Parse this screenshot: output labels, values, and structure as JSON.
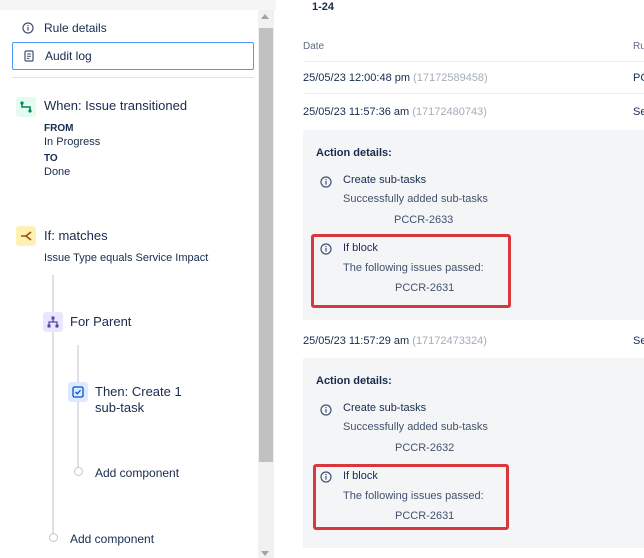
{
  "nav": {
    "rule_details": "Rule details",
    "audit_log": "Audit log"
  },
  "components": {
    "trigger": {
      "title": "When: Issue transitioned",
      "from_label": "FROM",
      "from_value": "In Progress",
      "to_label": "TO",
      "to_value": "Done"
    },
    "condition": {
      "title": "If: matches",
      "subtitle": "Issue Type equals Service Impact"
    },
    "branch": {
      "title": "For Parent"
    },
    "action": {
      "title_line1": "Then: Create 1",
      "title_line2": "sub-task"
    },
    "add_component_inner": "Add component",
    "add_component_outer": "Add component"
  },
  "audit": {
    "range": "1-24",
    "columns": {
      "date": "Date",
      "rule": "Ru"
    },
    "rows": [
      {
        "date": "25/05/23 12:00:48 pm",
        "id": "(17172589458)",
        "status": "PC"
      },
      {
        "date": "25/05/23 11:57:36 am",
        "id": "(17172480743)",
        "status": "Se"
      },
      {
        "date": "25/05/23 11:57:29 am",
        "id": "(17172473324)",
        "status": "Se"
      }
    ],
    "details": [
      {
        "heading": "Action details:",
        "actions": [
          {
            "title": "Create sub-tasks",
            "desc": "Successfully added sub-tasks",
            "key": "PCCR-2633"
          },
          {
            "title": "If block",
            "desc": "The following issues passed:",
            "key": "PCCR-2631"
          }
        ]
      },
      {
        "heading": "Action details:",
        "actions": [
          {
            "title": "Create sub-tasks",
            "desc": "Successfully added sub-tasks",
            "key": "PCCR-2632"
          },
          {
            "title": "If block",
            "desc": "The following issues passed:",
            "key": "PCCR-2631"
          }
        ]
      }
    ]
  },
  "colors": {
    "highlight": "#d9363e",
    "focus_border": "#4c9aff",
    "trigger_icon_bg": "#e3fcef",
    "condition_icon_bg": "#fff0b3",
    "branch_icon_bg": "#eae6ff",
    "action_icon_bg": "#deebff"
  },
  "icons": {
    "rule_details": "info-icon",
    "audit_log": "document-icon",
    "trigger": "transition-icon",
    "condition": "branch-condition-icon",
    "branch": "hierarchy-icon",
    "action": "create-subtask-icon",
    "action_detail": "info-icon"
  }
}
